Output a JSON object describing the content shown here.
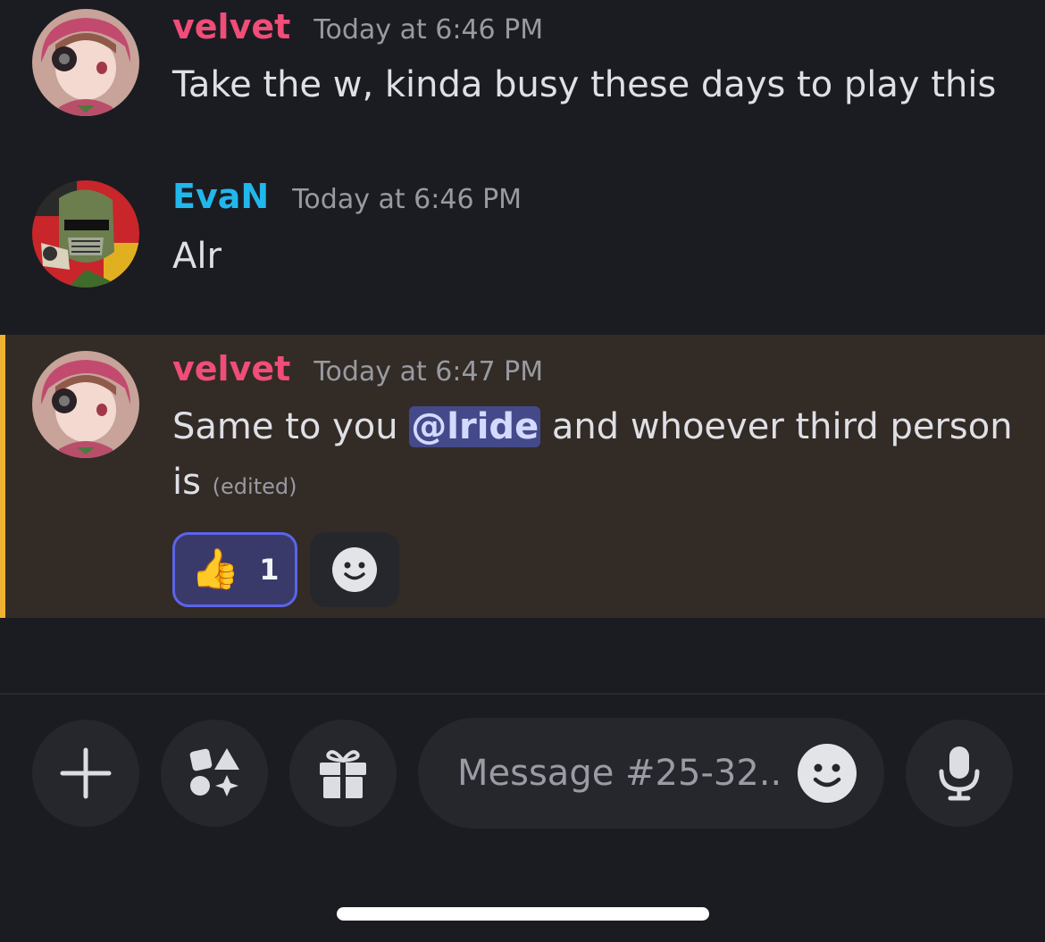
{
  "messages": [
    {
      "username": "velvet",
      "timestamp": "Today at 6:46 PM",
      "text": "Take the w, kinda busy these days to play this"
    },
    {
      "username": "EvaN",
      "timestamp": "Today at 6:46 PM",
      "text": "Alr"
    },
    {
      "username": "velvet",
      "timestamp": "Today at 6:47 PM",
      "text_before": "Same to you ",
      "mention": "@lride",
      "text_after": " and whoever third person",
      "text_line2": "is",
      "edited": "(edited)",
      "reactions": [
        {
          "emoji": "👍",
          "count": "1"
        }
      ]
    }
  ],
  "composer": {
    "placeholder": "Message #25-32.."
  },
  "icons": {
    "plus": "plus-icon",
    "apps": "apps-icon",
    "gift": "gift-icon",
    "emoji": "smiley-icon",
    "mic": "microphone-icon"
  },
  "colors": {
    "background": "#1b1c21",
    "highlight": "#332b26",
    "highlight_bar": "#f0b232",
    "velvet": "#f04d78",
    "evan": "#22b7ec",
    "mention_bg": "#444a89",
    "reaction_border": "#5b64ea"
  }
}
